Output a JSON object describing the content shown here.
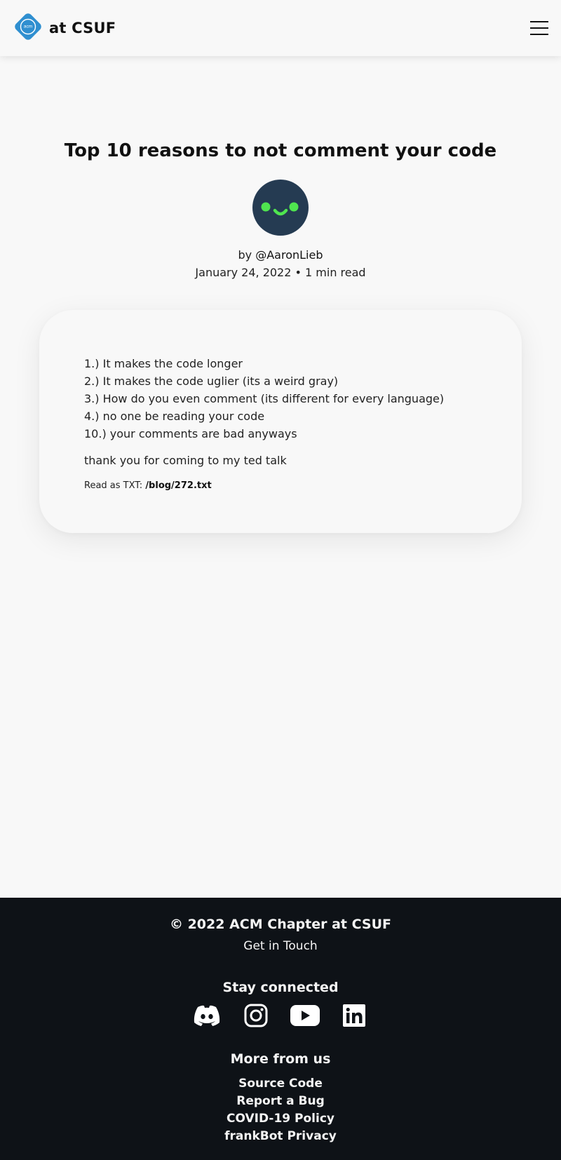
{
  "header": {
    "brand_title": "at CSUF",
    "logo_text": "acm",
    "logo_color": "#2f8fd0",
    "menu_icon": "hamburger-menu-icon"
  },
  "post": {
    "title": "Top 10 reasons to not comment your code",
    "author_prefix": "by ",
    "author": "@AaronLieb",
    "meta": "January 24, 2022 • 1 min read",
    "avatar_bg": "#253b52",
    "avatar_accent": "#4fe54f",
    "reasons": [
      "1.) It makes the code longer",
      "2.) It makes the code uglier (its a weird gray)",
      "3.) How do you even comment (its different for every language)",
      "4.) no one be reading your code",
      "10.) your comments are bad anyways"
    ],
    "closing": "thank you for coming to my ted talk",
    "txt_label": "Read as TXT: ",
    "txt_link": "/blog/272.txt"
  },
  "footer": {
    "copyright": "© 2022 ACM Chapter at CSUF",
    "get_in_touch": "Get in Touch",
    "stay_connected": "Stay connected",
    "social_icons": [
      "discord-icon",
      "instagram-icon",
      "youtube-icon",
      "linkedin-icon"
    ],
    "more_from_us": "More from us",
    "links": [
      "Source Code",
      "Report a Bug",
      "COVID-19 Policy",
      "frankBot Privacy"
    ],
    "background": "#0e1217"
  }
}
